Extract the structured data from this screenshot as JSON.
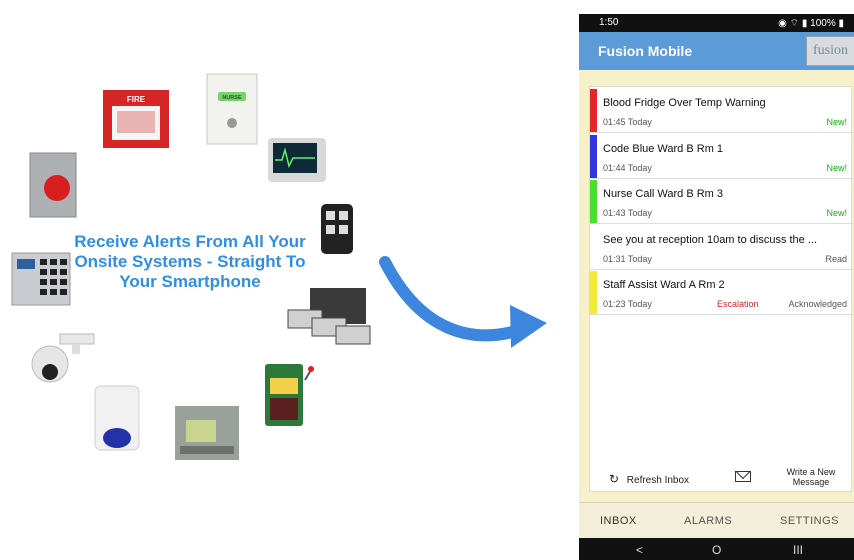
{
  "left_panel": {
    "headline": "Receive Alerts From All Your Onsite Systems - Straight To Your Smartphone",
    "fire_alarm_label": "FIRE",
    "nurse_label": "NURSE",
    "accent": "#2f8fe6"
  },
  "phone": {
    "status_time": "1:50",
    "battery": "100%",
    "app_title": "Fusion Mobile",
    "logo_text": "fusion",
    "messages": [
      {
        "subject": "Blood Fridge Over Temp Warning",
        "time": "01:45 Today",
        "status": "New!",
        "color": "#e6252a"
      },
      {
        "subject": "Code Blue Ward B Rm 1",
        "time": "01:44 Today",
        "status": "New!",
        "color": "#2f35e0"
      },
      {
        "subject": "Nurse Call Ward B Rm 3",
        "time": "01:43 Today",
        "status": "New!",
        "color": "#48e02f"
      },
      {
        "subject": "See you at reception 10am to discuss the ...",
        "time": "01:31 Today",
        "status": "Read",
        "color": "#ffffff"
      },
      {
        "subject": "Staff Assist Ward A Rm 2",
        "time": "01:23 Today",
        "escalation": "Escalation",
        "status": "Acknowledged",
        "color": "#f1ea39"
      }
    ],
    "refresh_label": "Refresh Inbox",
    "write_label": "Write a New Message",
    "tabs": [
      "INBOX",
      "ALARMS",
      "SETTINGS"
    ],
    "nav": {
      "back": "<",
      "home": "O",
      "recent": "III"
    }
  }
}
